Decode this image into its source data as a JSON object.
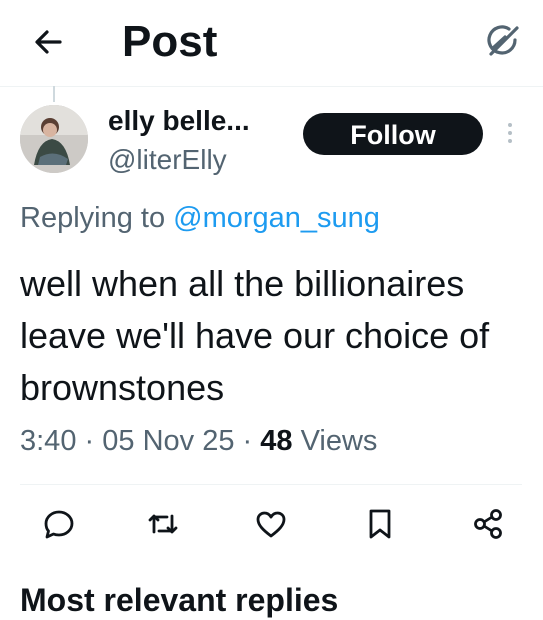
{
  "header": {
    "back_icon": "arrow-left-icon",
    "title": "Post",
    "grok_icon": "grok-icon"
  },
  "post": {
    "author": {
      "name": "elly belle...",
      "handle": "@literElly"
    },
    "follow_label": "Follow",
    "replying_prefix": "Replying to",
    "replying_to": "@morgan_sung",
    "text": "well when all the billionaires leave we'll have our choice of brownstones",
    "time": "3:40",
    "separator": "·",
    "date": "05 Nov 25",
    "views_count": "48",
    "views_label": "Views"
  },
  "actions": [
    "reply-icon",
    "repost-icon",
    "like-icon",
    "bookmark-icon",
    "share-icon"
  ],
  "section": {
    "heading": "Most relevant replies"
  },
  "colors": {
    "accent": "#1d9bf0",
    "text": "#0f1419",
    "secondary": "#536471",
    "follow_bg": "#0f1419"
  }
}
